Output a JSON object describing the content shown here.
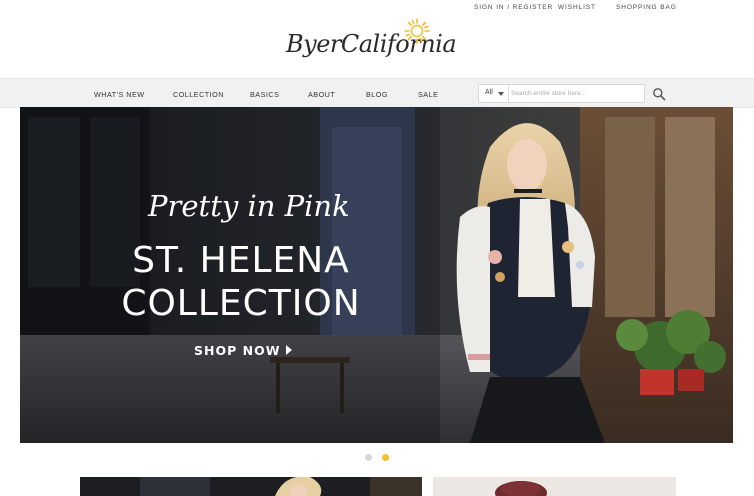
{
  "header": {
    "links": {
      "sign_in": "SIGN IN / REGISTER",
      "wishlist": "WISHLIST",
      "shopping_bag": "SHOPPING BAG"
    },
    "logo_text": "ByerCalifornia"
  },
  "nav": {
    "items": [
      "WHAT'S NEW",
      "COLLECTION",
      "BASICS",
      "ABOUT",
      "BLOG",
      "SALE"
    ]
  },
  "search": {
    "scope": "All",
    "placeholder": "Search entire store here..."
  },
  "hero": {
    "tagline": "Pretty in Pink",
    "title_line1": "ST. HELENA",
    "title_line2": "COLLECTION",
    "cta": "SHOP NOW"
  },
  "carousel": {
    "slide_count": 2,
    "active_index": 1
  },
  "colors": {
    "accent_dot": "#f5c02a",
    "inactive_dot": "#d6d6d6",
    "sun": "#f2bf2c",
    "nav_bg": "#f1f1f1"
  }
}
